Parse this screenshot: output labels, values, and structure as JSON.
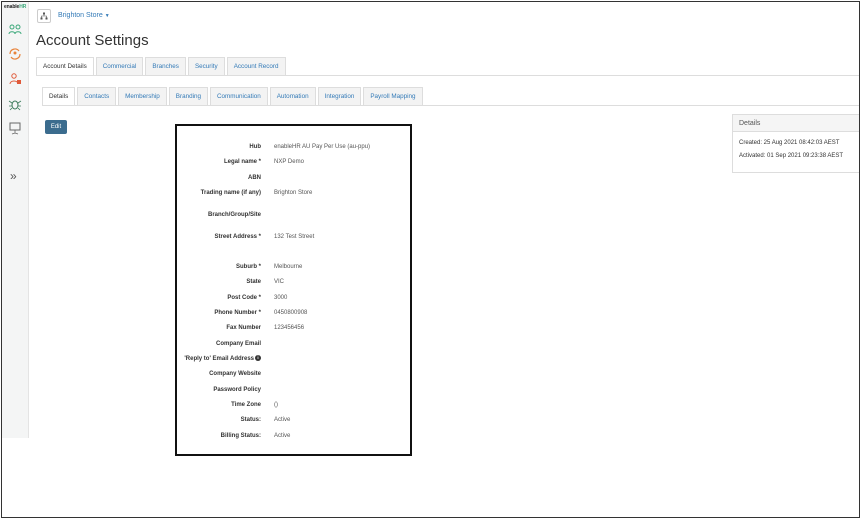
{
  "app": {
    "logo": {
      "prefix": "enable",
      "suffix": "HR"
    },
    "rail_expand_glyph": "»",
    "rail_icons": [
      "people-icon",
      "refresh-person-icon",
      "person-alert-icon",
      "bug-icon",
      "presentation-icon"
    ]
  },
  "header": {
    "org_name": "Brighton Store",
    "title": "Account Settings"
  },
  "primary_tabs": [
    {
      "label": "Account Details",
      "active": true
    },
    {
      "label": "Commercial",
      "active": false
    },
    {
      "label": "Branches",
      "active": false
    },
    {
      "label": "Security",
      "active": false
    },
    {
      "label": "Account Record",
      "active": false
    }
  ],
  "secondary_tabs": [
    {
      "label": "Details",
      "active": true
    },
    {
      "label": "Contacts",
      "active": false
    },
    {
      "label": "Membership",
      "active": false
    },
    {
      "label": "Branding",
      "active": false
    },
    {
      "label": "Communication",
      "active": false
    },
    {
      "label": "Automation",
      "active": false
    },
    {
      "label": "Integration",
      "active": false
    },
    {
      "label": "Payroll Mapping",
      "active": false
    }
  ],
  "edit_label": "Edit",
  "fields": [
    {
      "label": "Hub",
      "value": "enableHR AU Pay Per Use (au-ppu)"
    },
    {
      "label": "Legal name *",
      "value": "NXP Demo"
    },
    {
      "label": "ABN",
      "value": ""
    },
    {
      "label": "Trading name (if any)",
      "value": "Brighton Store"
    },
    {
      "label": "Branch/Group/Site",
      "value": ""
    },
    {
      "label": "Street Address *",
      "value": "132 Test Street"
    },
    {
      "label": "Suburb *",
      "value": "Melbourne"
    },
    {
      "label": "State",
      "value": "VIC"
    },
    {
      "label": "Post Code *",
      "value": "3000"
    },
    {
      "label": "Phone Number *",
      "value": "0450800908"
    },
    {
      "label": "Fax Number",
      "value": "123456456"
    },
    {
      "label": "Company Email",
      "value": ""
    },
    {
      "label": "'Reply to' Email Address",
      "value": "",
      "info": true
    },
    {
      "label": "Company Website",
      "value": ""
    },
    {
      "label": "Password Policy",
      "value": ""
    },
    {
      "label": "Time Zone",
      "value": "()"
    },
    {
      "label": "Status:",
      "value": "Active"
    },
    {
      "label": "Billing Status:",
      "value": "Active"
    }
  ],
  "side_panel": {
    "title": "Details",
    "created": "Created: 25 Aug 2021 08:42:03 AEST",
    "activated": "Activated: 01 Sep 2021 09:23:38 AEST"
  },
  "colors": {
    "accent": "#337ab7",
    "edit_button": "#3b6c8e",
    "brand_green": "#3ba87a",
    "icon_orange": "#e8833a"
  }
}
